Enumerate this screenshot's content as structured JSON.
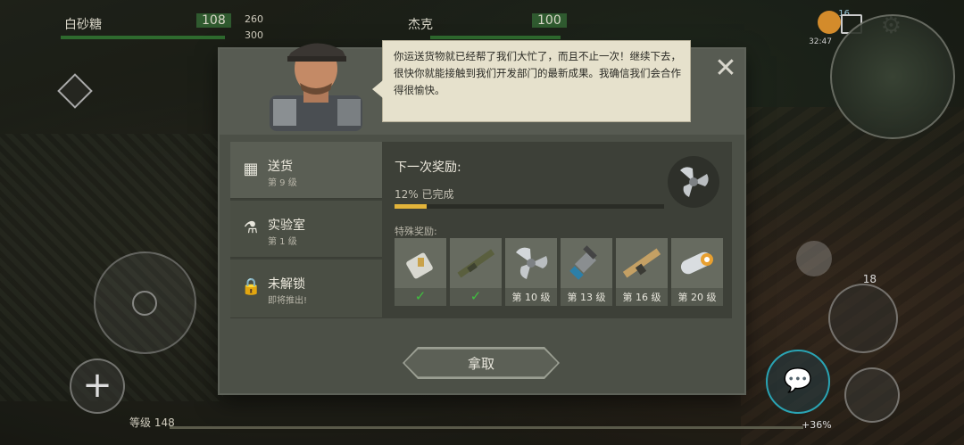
{
  "hud": {
    "player1_name": "白砂糖",
    "player1_hp": "108",
    "stat_energy": "260",
    "stat_other": "300",
    "player2_name": "杰克",
    "player2_hp": "100",
    "badge_count": "16",
    "clock": "32:47",
    "level_label": "等级 148",
    "xp_percent": "+36%",
    "ammo": "18"
  },
  "dialog": {
    "speech": "你运送货物就已经帮了我们大忙了，而且不止一次！继续下去，很快你就能接触到我们开发部门的最新成果。我确信我们会合作得很愉快。",
    "tabs": [
      {
        "title": "送货",
        "subtitle": "第 9 级",
        "icon": "boxes-icon",
        "active": true
      },
      {
        "title": "实验室",
        "subtitle": "第 1 级",
        "icon": "flask-icon",
        "active": false
      },
      {
        "title": "未解锁",
        "subtitle": "即将推出!",
        "icon": "lock-icon",
        "active": false
      }
    ],
    "next_reward_label": "下一次奖励:",
    "progress_text": "12% 已完成",
    "progress_value": 0.12,
    "special_label": "特殊奖励:",
    "rewards": [
      {
        "icon": "part-icon",
        "label": "",
        "claimed": true
      },
      {
        "icon": "rifle-icon",
        "label": "",
        "claimed": true
      },
      {
        "icon": "propeller-icon",
        "label": "第 10 级",
        "claimed": false
      },
      {
        "icon": "drill-icon",
        "label": "第 13 级",
        "claimed": false
      },
      {
        "icon": "gun-icon",
        "label": "第 16 级",
        "claimed": false
      },
      {
        "icon": "scroll-icon",
        "label": "第 20 级",
        "claimed": false
      }
    ],
    "take_button": "拿取"
  },
  "colors": {
    "accent": "#e3b43a",
    "check": "#3fbf3f",
    "hp": "#2e6a2e"
  }
}
